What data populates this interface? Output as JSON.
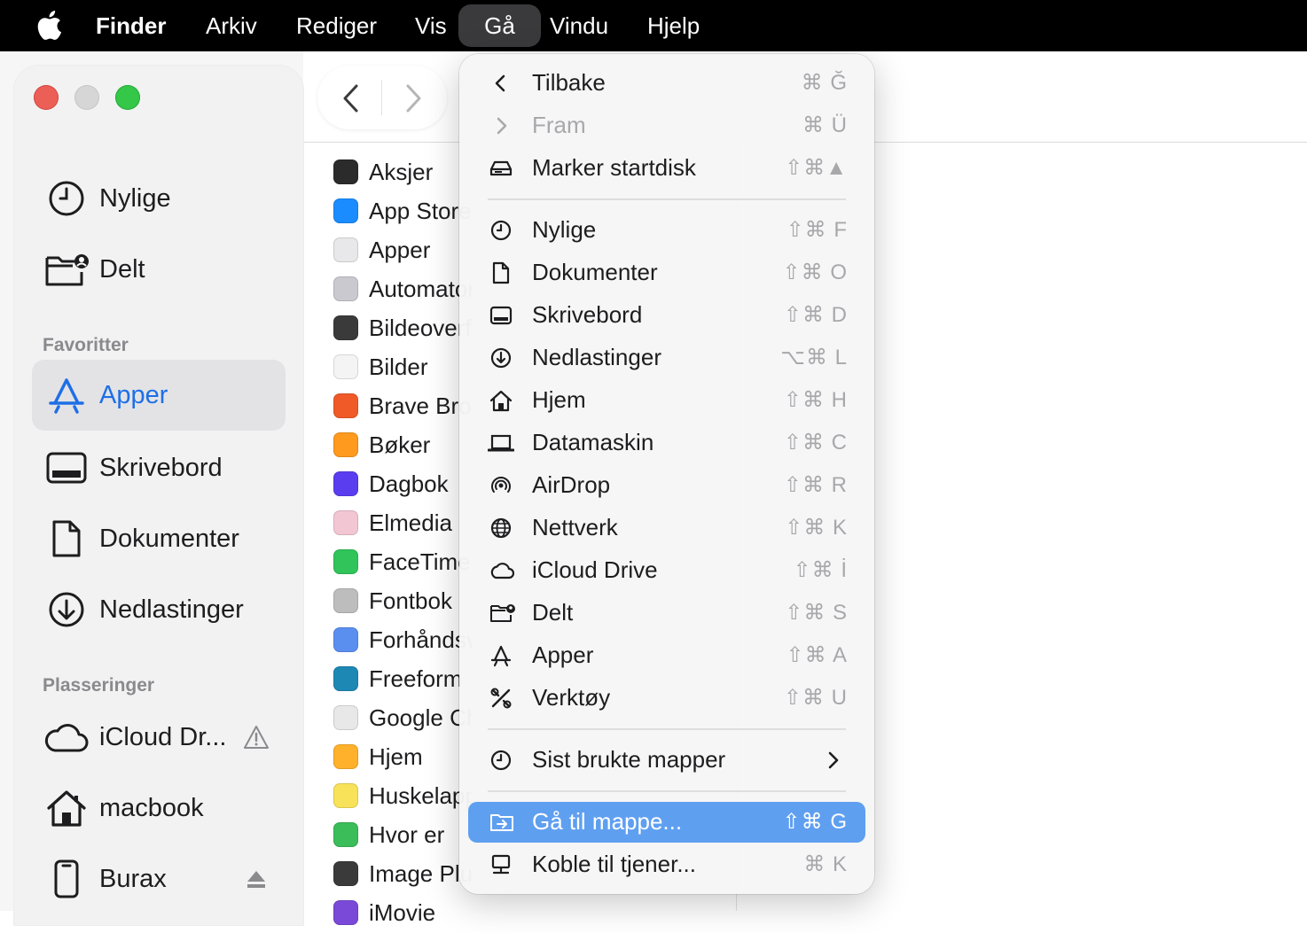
{
  "menubar": {
    "items": [
      {
        "label": "Finder",
        "bold": true
      },
      {
        "label": "Arkiv"
      },
      {
        "label": "Rediger"
      },
      {
        "label": "Vis"
      },
      {
        "label": "Gå",
        "active": true
      },
      {
        "label": "Vindu"
      },
      {
        "label": "Hjelp"
      }
    ]
  },
  "sidebar": {
    "top_items": [
      {
        "label": "Nylige",
        "icon": "clock-icon"
      },
      {
        "label": "Delt",
        "icon": "shared-folder-icon"
      }
    ],
    "favorites_header": "Favoritter",
    "favorites": [
      {
        "label": "Apper",
        "icon": "apps-icon",
        "selected": true
      },
      {
        "label": "Skrivebord",
        "icon": "desktop-icon"
      },
      {
        "label": "Dokumenter",
        "icon": "document-icon"
      },
      {
        "label": "Nedlastinger",
        "icon": "download-icon"
      }
    ],
    "locations_header": "Plasseringer",
    "locations": [
      {
        "label": "iCloud Dr...",
        "icon": "cloud-icon",
        "trailing": "warning-icon"
      },
      {
        "label": "macbook",
        "icon": "home-icon"
      },
      {
        "label": "Burax",
        "icon": "phone-icon",
        "trailing": "eject-icon"
      }
    ]
  },
  "files": [
    {
      "name": "Aksjer",
      "color": "#2b2b2b"
    },
    {
      "name": "App Store",
      "color": "#1a8cff"
    },
    {
      "name": "Apper",
      "color": "#e8e8ea"
    },
    {
      "name": "Automator",
      "color": "#c9c9cf"
    },
    {
      "name": "Bildeoverføring",
      "color": "#3a3a3a"
    },
    {
      "name": "Bilder",
      "color": "#f4f4f4"
    },
    {
      "name": "Brave Browser",
      "color": "#f05a28"
    },
    {
      "name": "Bøker",
      "color": "#ff9a1f"
    },
    {
      "name": "Dagbok",
      "color": "#5b3df0"
    },
    {
      "name": "Elmedia",
      "color": "#f2c6d3"
    },
    {
      "name": "FaceTime",
      "color": "#30c45a"
    },
    {
      "name": "Fontbok",
      "color": "#bdbdbd"
    },
    {
      "name": "Forhåndsvisning",
      "color": "#5a8ff0"
    },
    {
      "name": "Freeform",
      "color": "#1e88b5"
    },
    {
      "name": "Google Chrome",
      "color": "#e8e8e8"
    },
    {
      "name": "Hjem",
      "color": "#ffb12b"
    },
    {
      "name": "Huskelapper",
      "color": "#f7e25a"
    },
    {
      "name": "Hvor er",
      "color": "#3bbd5a"
    },
    {
      "name": "Image Plus",
      "color": "#3a3a3a"
    },
    {
      "name": "iMovie",
      "color": "#7a49d8"
    }
  ],
  "go_menu": {
    "groups": [
      [
        {
          "label": "Tilbake",
          "icon": "chevron-left-icon",
          "shortcut": "⌘ Ğ"
        },
        {
          "label": "Fram",
          "icon": "chevron-right-icon",
          "shortcut": "⌘ Ü",
          "disabled": true
        },
        {
          "label": "Marker startdisk",
          "icon": "drive-icon",
          "shortcut": "⇧⌘▲"
        }
      ],
      [
        {
          "label": "Nylige",
          "icon": "clock-icon",
          "shortcut": "⇧⌘ F"
        },
        {
          "label": "Dokumenter",
          "icon": "document-icon",
          "shortcut": "⇧⌘ O"
        },
        {
          "label": "Skrivebord",
          "icon": "desktop-icon",
          "shortcut": "⇧⌘ D"
        },
        {
          "label": "Nedlastinger",
          "icon": "download-icon",
          "shortcut": "⌥⌘ L"
        },
        {
          "label": "Hjem",
          "icon": "home-icon",
          "shortcut": "⇧⌘ H"
        },
        {
          "label": "Datamaskin",
          "icon": "laptop-icon",
          "shortcut": "⇧⌘ C"
        },
        {
          "label": "AirDrop",
          "icon": "airdrop-icon",
          "shortcut": "⇧⌘ R"
        },
        {
          "label": "Nettverk",
          "icon": "globe-icon",
          "shortcut": "⇧⌘ K"
        },
        {
          "label": "iCloud Drive",
          "icon": "cloud-icon",
          "shortcut": "⇧⌘ İ"
        },
        {
          "label": "Delt",
          "icon": "shared-folder-icon",
          "shortcut": "⇧⌘ S"
        },
        {
          "label": "Apper",
          "icon": "apps-icon",
          "shortcut": "⇧⌘ A"
        },
        {
          "label": "Verktøy",
          "icon": "tools-icon",
          "shortcut": "⇧⌘ U"
        }
      ],
      [
        {
          "label": "Sist brukte mapper",
          "icon": "clock-icon",
          "submenu": true
        }
      ],
      [
        {
          "label": "Gå til mappe...",
          "icon": "goto-folder-icon",
          "shortcut": "⇧⌘ G",
          "highlight": true
        },
        {
          "label": "Koble til tjener...",
          "icon": "server-icon",
          "shortcut": "⌘ K"
        }
      ]
    ]
  },
  "colors": {
    "accent": "#1e6fe6",
    "menu_highlight": "#5f9ff0"
  }
}
